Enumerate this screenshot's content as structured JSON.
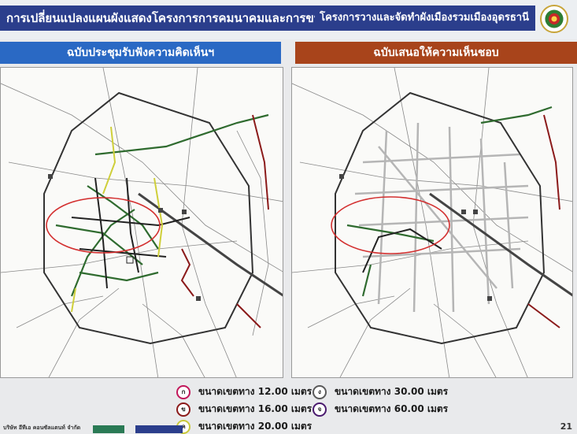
{
  "header": {
    "title": "การเปลี่ยนแปลงแผนผังแสดงโครงการการคมนาคมและการขนส่ง",
    "project": "โครงการวางและจัดทำผังเมืองรวมเมืองอุดรธานี"
  },
  "panes": {
    "left_title": "ฉบับประชุมรับฟังความคิดเห็นฯ",
    "right_title": "ฉบับเสนอให้ความเห็นชอบ"
  },
  "legend": {
    "items": [
      {
        "code": "ก",
        "label": "ขนาดเขตทาง 12.00 เมตร",
        "color": "#c2185b"
      },
      {
        "code": "ข",
        "label": "ขนาดเขตทาง 16.00 เมตร",
        "color": "#8b1a1a"
      },
      {
        "code": "ค",
        "label": "ขนาดเขตทาง 20.00 เมตร",
        "color": "#c9c93a"
      },
      {
        "code": "ง",
        "label": "ขนาดเขตทาง 30.00 เมตร",
        "color": "#5a5a5a"
      },
      {
        "code": "จ",
        "label": "ขนาดเขตทาง 60.00 เมตร",
        "color": "#4a1a6e"
      }
    ]
  },
  "footer": {
    "logo_text": "บริษัท อีทีเอ คอนซัลแตนท์ จำกัด",
    "page_number": "21"
  }
}
